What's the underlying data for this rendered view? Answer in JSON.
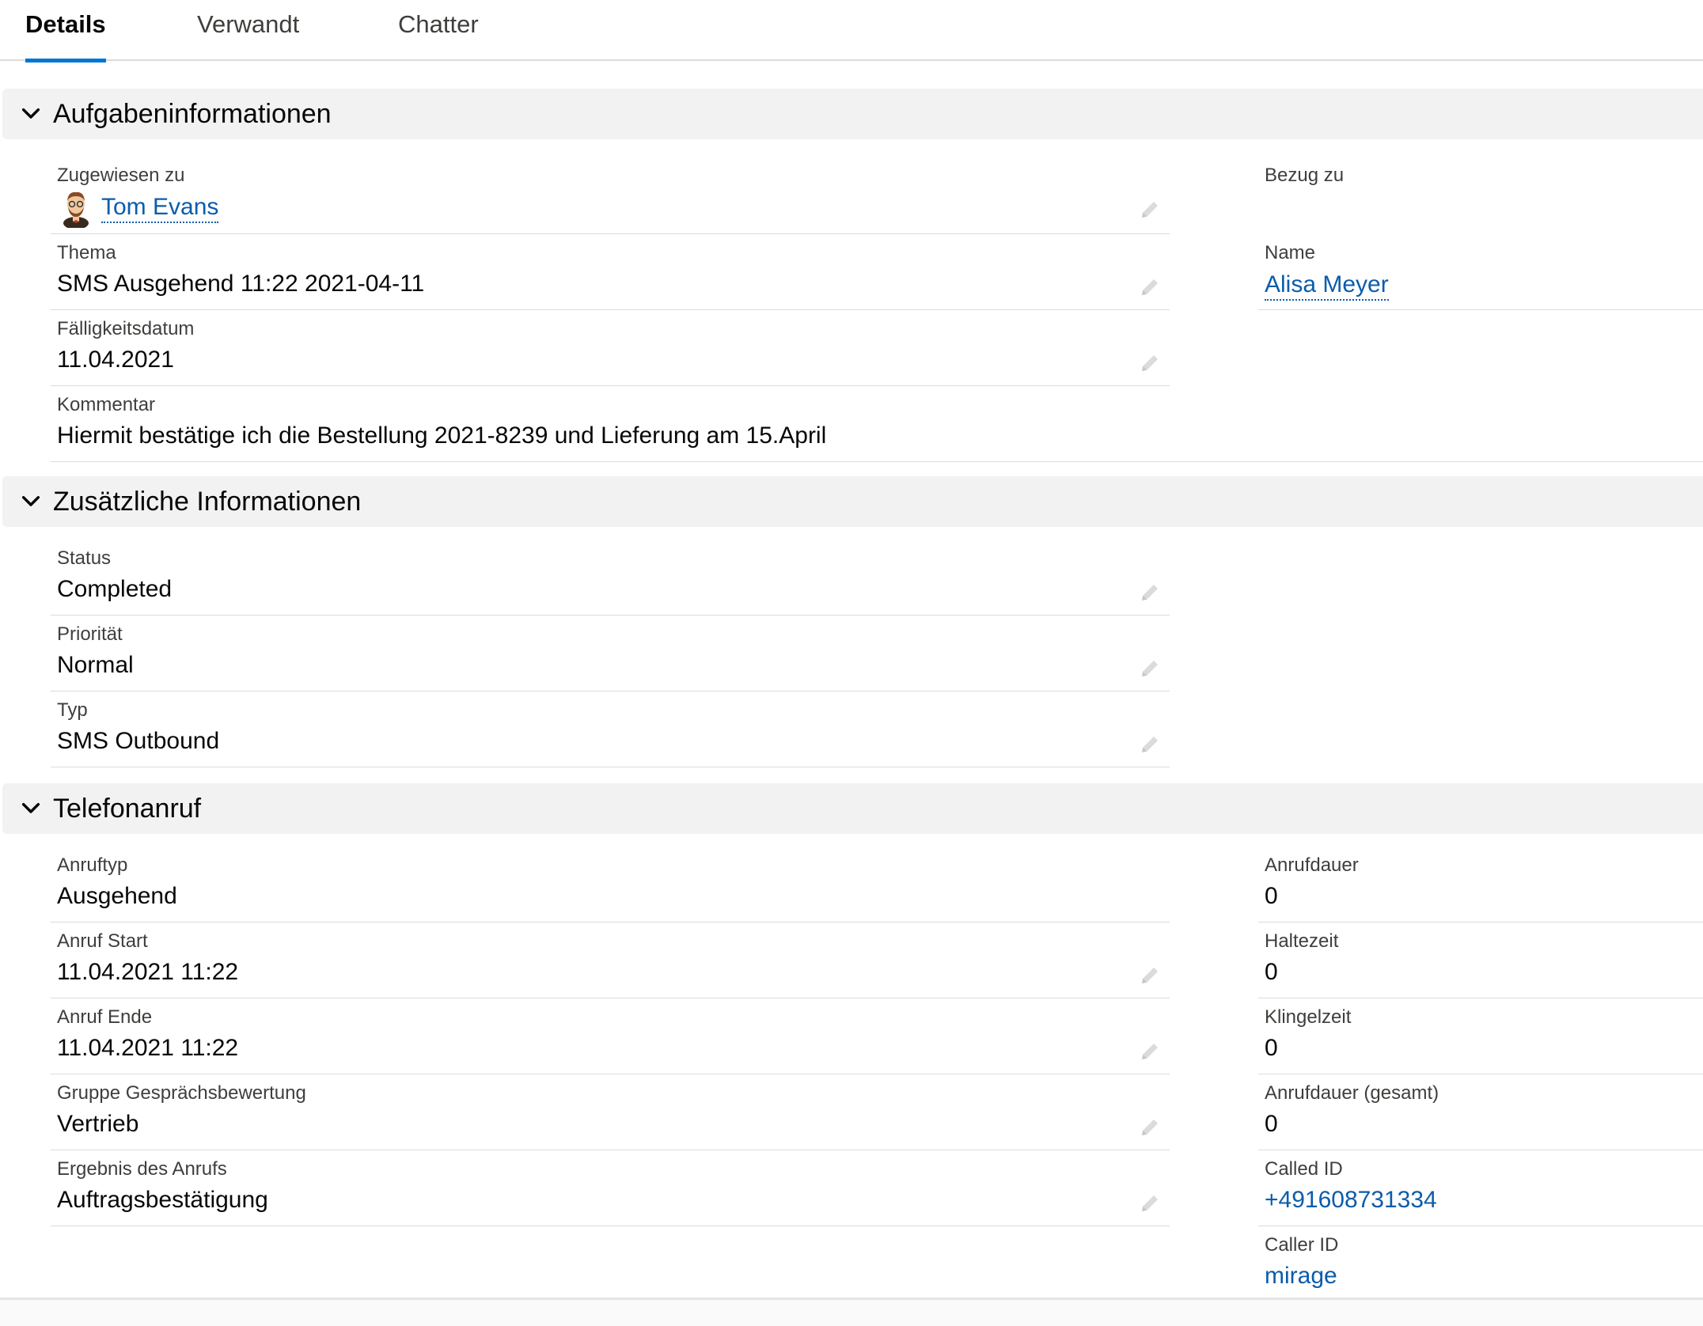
{
  "tabs": [
    {
      "label": "Details",
      "active": true
    },
    {
      "label": "Verwandt",
      "active": false
    },
    {
      "label": "Chatter",
      "active": false
    }
  ],
  "sections": {
    "task_info": {
      "title": "Aufgabeninformationen",
      "assigned_to": {
        "label": "Zugewiesen zu",
        "value": "Tom Evans"
      },
      "related_to": {
        "label": "Bezug zu",
        "value": ""
      },
      "subject": {
        "label": "Thema",
        "value": "SMS Ausgehend 11:22 2021-04-11"
      },
      "name": {
        "label": "Name",
        "value": "Alisa Meyer"
      },
      "due_date": {
        "label": "Fälligkeitsdatum",
        "value": "11.04.2021"
      },
      "comment": {
        "label": "Kommentar",
        "value": "Hiermit bestätige ich die Bestellung 2021-8239 und Lieferung am 15.April"
      }
    },
    "additional_info": {
      "title": "Zusätzliche Informationen",
      "status": {
        "label": "Status",
        "value": "Completed"
      },
      "priority": {
        "label": "Priorität",
        "value": "Normal"
      },
      "type": {
        "label": "Typ",
        "value": "SMS Outbound"
      }
    },
    "phone_call": {
      "title": "Telefonanruf",
      "call_type": {
        "label": "Anruftyp",
        "value": "Ausgehend"
      },
      "call_start": {
        "label": "Anruf Start",
        "value": "11.04.2021 11:22"
      },
      "call_end": {
        "label": "Anruf Ende",
        "value": "11.04.2021 11:22"
      },
      "rating_group": {
        "label": "Gruppe Gesprächsbewertung",
        "value": "Vertrieb"
      },
      "call_result": {
        "label": "Ergebnis des Anrufs",
        "value": "Auftragsbestätigung"
      },
      "call_duration": {
        "label": "Anrufdauer",
        "value": "0"
      },
      "hold_time": {
        "label": "Haltezeit",
        "value": "0"
      },
      "ring_time": {
        "label": "Klingelzeit",
        "value": "0"
      },
      "total_duration": {
        "label": "Anrufdauer (gesamt)",
        "value": "0"
      },
      "called_id": {
        "label": "Called ID",
        "value": "+491608731334"
      },
      "caller_id": {
        "label": "Caller ID",
        "value": "mirage"
      }
    }
  },
  "icons": {
    "chevron": "chevron-down-icon",
    "edit": "pencil-icon",
    "avatar": "user-avatar-icon"
  },
  "colors": {
    "link": "#0b5cab",
    "tab_active_underline": "#0176d3",
    "section_header_bg": "#f3f2f2"
  }
}
